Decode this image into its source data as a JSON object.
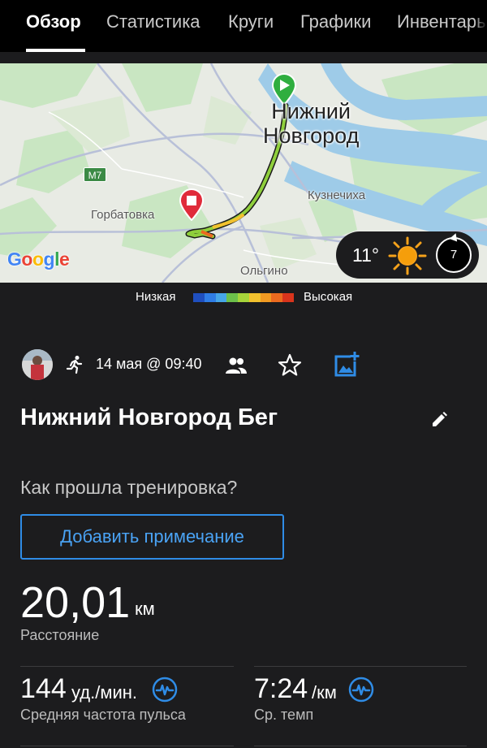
{
  "tabs": [
    {
      "label": "Обзор",
      "active": true
    },
    {
      "label": "Статистика",
      "active": false
    },
    {
      "label": "Круги",
      "active": false
    },
    {
      "label": "Графики",
      "active": false
    },
    {
      "label": "Инвентарь",
      "active": false
    }
  ],
  "map": {
    "city_line1": "Нижний",
    "city_line2": "Новгород",
    "place_kuznechikha": "Кузнечиха",
    "place_gorbatovka": "Горбатовка",
    "place_olgino": "Ольгино",
    "road_badge": "M7",
    "attribution": {
      "letters": [
        "G",
        "o",
        "o",
        "g",
        "l",
        "e"
      ],
      "colors": [
        "#4285F4",
        "#EA4335",
        "#FBBC05",
        "#4285F4",
        "#34A853",
        "#EA4335"
      ]
    },
    "start_marker_color": "#2fae3f",
    "finish_marker_color": "#e02b3a",
    "weather": {
      "temperature": "11°",
      "wind_speed": "7",
      "condition_icon": "sun-icon"
    }
  },
  "legend": {
    "low_label": "Низкая",
    "high_label": "Высокая",
    "colors": [
      "#1f4fbf",
      "#2f7de6",
      "#46a6e8",
      "#6cc04a",
      "#a6d43a",
      "#f2c12e",
      "#f29a22",
      "#ec6a1f",
      "#d9341c"
    ]
  },
  "activity": {
    "activity_icon": "running-icon",
    "date": "14 мая @ 09:40",
    "title": "Нижний Новгород Бег",
    "question": "Как прошла тренировка?",
    "add_note_label": "Добавить примечание"
  },
  "stats": {
    "distance_value": "20,01",
    "distance_unit": "км",
    "distance_label": "Расстояние",
    "hr_value": "144",
    "hr_unit": "уд./мин.",
    "hr_label": "Средняя частота пульса",
    "pace_value": "7:24",
    "pace_unit": "/км",
    "pace_label": "Ср. темп"
  },
  "colors": {
    "accent": "#2f8ce6",
    "background": "#1c1c1e",
    "route": "#8fcf3c"
  }
}
